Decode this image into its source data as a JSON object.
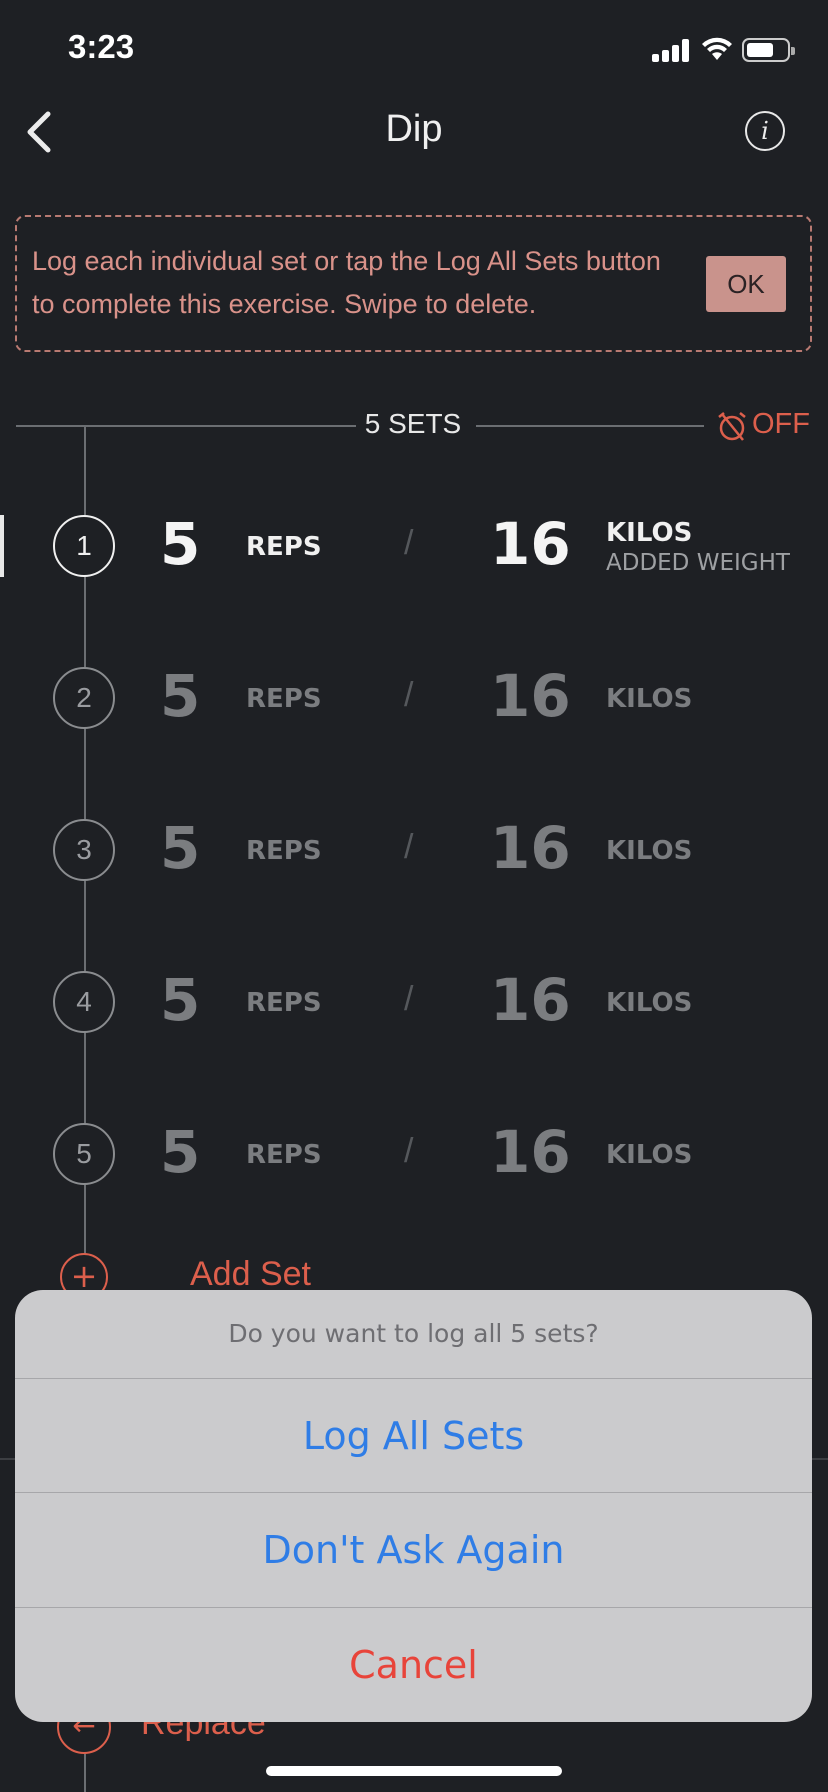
{
  "status_bar": {
    "time": "3:23"
  },
  "nav": {
    "title": "Dip"
  },
  "tip": {
    "text": "Log each individual set or tap the Log All Sets button to complete this exercise. Swipe to delete.",
    "ok_label": "OK"
  },
  "sets_header": {
    "label": "5 SETS",
    "timer_label": "OFF"
  },
  "sets": [
    {
      "number": "1",
      "reps": "5",
      "reps_label": "REPS",
      "slash": "/",
      "weight": "16",
      "unit": "KILOS",
      "sub_label": "ADDED WEIGHT",
      "active": true
    },
    {
      "number": "2",
      "reps": "5",
      "reps_label": "REPS",
      "slash": "/",
      "weight": "16",
      "unit": "KILOS"
    },
    {
      "number": "3",
      "reps": "5",
      "reps_label": "REPS",
      "slash": "/",
      "weight": "16",
      "unit": "KILOS"
    },
    {
      "number": "4",
      "reps": "5",
      "reps_label": "REPS",
      "slash": "/",
      "weight": "16",
      "unit": "KILOS"
    },
    {
      "number": "5",
      "reps": "5",
      "reps_label": "REPS",
      "slash": "/",
      "weight": "16",
      "unit": "KILOS"
    }
  ],
  "add_set": {
    "label": "Add Set"
  },
  "replace": {
    "label": "Replace"
  },
  "action_sheet": {
    "title": "Do you want to log all 5 sets?",
    "log_all_label": "Log All Sets",
    "dont_ask_label": "Don't Ask Again",
    "cancel_label": "Cancel"
  },
  "colors": {
    "background": "#1e2024",
    "accent_red": "#dc5f4c",
    "tip_text": "#d9928a",
    "sheet_bg": "#cbcbcd",
    "ios_blue": "#2f7de6",
    "destructive": "#e8443a"
  },
  "icons": {
    "back": "chevron-left-icon",
    "info": "info-icon",
    "timer": "timer-off-icon",
    "add": "plus-circle-icon",
    "replace": "arrow-left-circle-icon"
  }
}
